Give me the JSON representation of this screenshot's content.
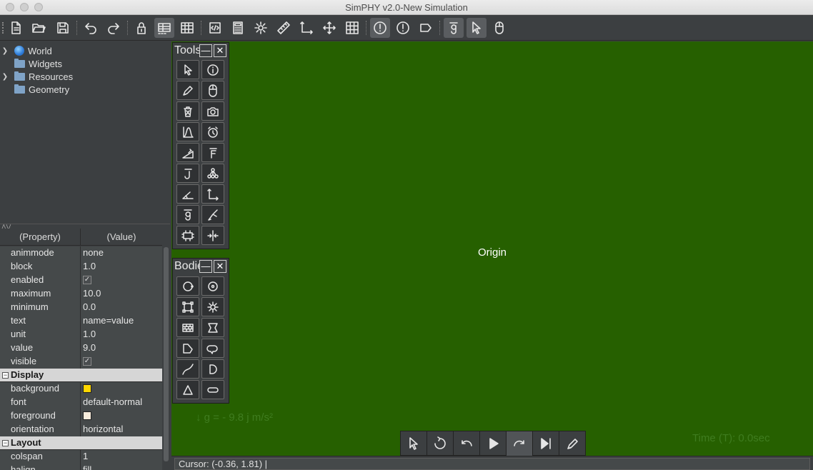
{
  "window": {
    "title": "SimPHY v2.0-New Simulation"
  },
  "toolbar": {
    "buttons": [
      "new-file",
      "open-folder",
      "save",
      "undo",
      "redo",
      "lock",
      "table-view",
      "grid-table",
      "script-editor",
      "calculator",
      "settings",
      "ruler",
      "axes",
      "move",
      "grid",
      "info-alert",
      "warning",
      "tag",
      "gravity-g",
      "select-pointer",
      "mouse"
    ]
  },
  "tree": {
    "items": [
      {
        "label": "World",
        "expandable": true,
        "icon": "globe-icon"
      },
      {
        "label": "Widgets",
        "expandable": false,
        "icon": "folder-icon"
      },
      {
        "label": "Resources",
        "expandable": true,
        "icon": "folder-icon"
      },
      {
        "label": "Geometry",
        "expandable": false,
        "icon": "folder-icon"
      }
    ]
  },
  "properties": {
    "header": {
      "property": "(Property)",
      "value": "(Value)"
    },
    "rows": [
      {
        "key": "animmode",
        "value": "none"
      },
      {
        "key": "block",
        "value": "1.0"
      },
      {
        "key": "enabled",
        "value": "✓"
      },
      {
        "key": "maximum",
        "value": "10.0"
      },
      {
        "key": "minimum",
        "value": "0.0"
      },
      {
        "key": "text",
        "value": "name=value"
      },
      {
        "key": "unit",
        "value": "1.0"
      },
      {
        "key": "value",
        "value": "9.0"
      },
      {
        "key": "visible",
        "value": "✓"
      }
    ],
    "display_category": "Display",
    "display_rows": [
      {
        "key": "background",
        "swatch": "#ffd700"
      },
      {
        "key": "font",
        "value": "default-normal"
      },
      {
        "key": "foreground",
        "swatch": "#f8ecdc"
      },
      {
        "key": "orientation",
        "value": "horizontal"
      }
    ],
    "layout_category": "Layout",
    "layout_rows": [
      {
        "key": "colspan",
        "value": "1"
      },
      {
        "key": "halign",
        "value": "fill"
      }
    ]
  },
  "tools_palette": {
    "title": "Tools",
    "min_label": "—",
    "close_label": "✕"
  },
  "bodies_palette": {
    "title": "Bodies",
    "min_label": "—",
    "close_label": "✕"
  },
  "canvas": {
    "background": "#266000",
    "origin_label": "Origin",
    "gravity_label": "g = - 9.8 j m/s²",
    "time_label": "Time (T): 0.0sec"
  },
  "playback": {
    "buttons": [
      "select",
      "reset",
      "step-back",
      "play",
      "step-forward",
      "skip-to-end",
      "pen"
    ]
  },
  "status": {
    "cursor": "Cursor: (-0.36, 1.81)  |"
  }
}
